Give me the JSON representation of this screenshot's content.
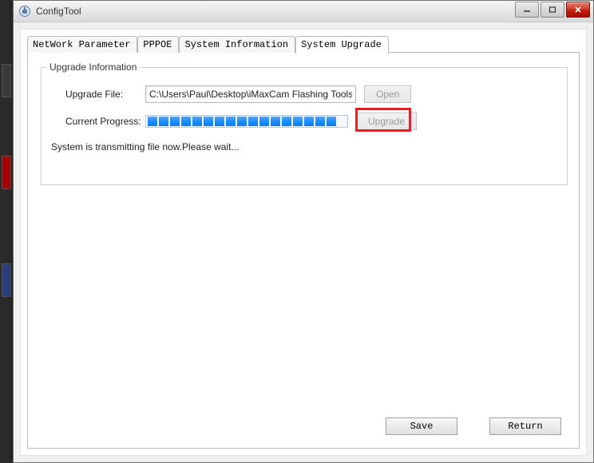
{
  "window": {
    "title": "ConfigTool"
  },
  "tabs": {
    "items": [
      {
        "label": "NetWork Parameter",
        "active": false
      },
      {
        "label": "PPPOE",
        "active": false
      },
      {
        "label": "System Information",
        "active": false
      },
      {
        "label": "System Upgrade",
        "active": true
      }
    ]
  },
  "group": {
    "legend": "Upgrade Information",
    "upgrade_file_label": "Upgrade File:",
    "upgrade_file_value": "C:\\Users\\Paul\\Desktop\\iMaxCam Flashing Tools\\",
    "open_button": "Open",
    "progress_label": "Current Progress:",
    "progress_segments": 17,
    "upgrade_button": "Upgrade",
    "status_text": "System is transmitting file now.Please wait..."
  },
  "buttons": {
    "save": "Save",
    "return": "Return"
  }
}
